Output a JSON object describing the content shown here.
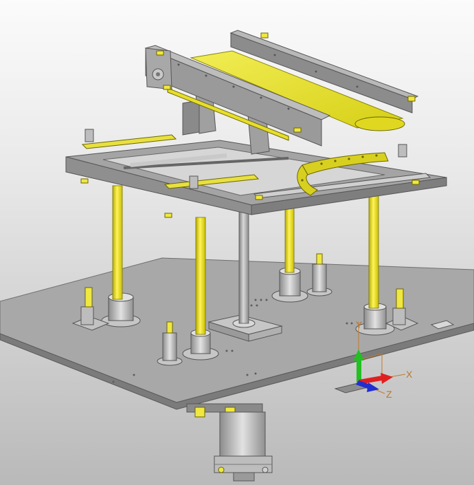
{
  "viewport": {
    "background_top": "#fbfbfb",
    "background_bottom": "#b9b9b9"
  },
  "model": {
    "colors": {
      "frame_gray": "#9e9e9e",
      "frame_dark": "#6a6a6a",
      "belt_yellow": "#e5e02a",
      "yellow_dark": "#b3ad0b",
      "plate_gray": "#a2a2a2",
      "plate_edge": "#7a7a7a"
    }
  },
  "triad": {
    "x_label": "X",
    "y_label": "Y",
    "z_label": "Z",
    "x_color": "#e02020",
    "y_color": "#22c022",
    "z_color": "#2030d0",
    "label_color": "#b8772c"
  }
}
